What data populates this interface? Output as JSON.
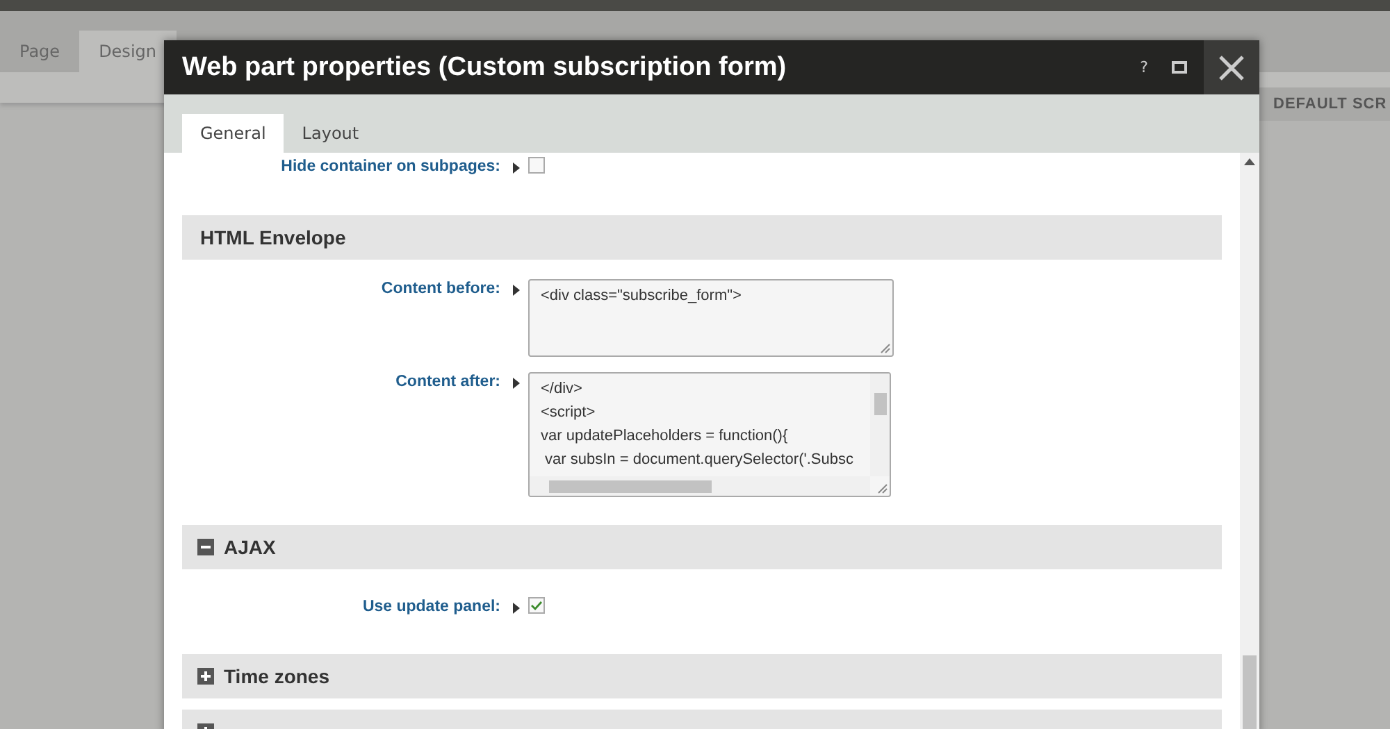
{
  "background": {
    "tabs": [
      {
        "label": "Page",
        "selected": false
      },
      {
        "label": "Design",
        "selected": true
      }
    ],
    "button": "DEFAULT SCR"
  },
  "dialog": {
    "title": "Web part properties (Custom subscription form)",
    "help": "?",
    "tabs": [
      {
        "label": "General",
        "selected": true
      },
      {
        "label": "Layout",
        "selected": false
      }
    ],
    "items": [
      {
        "kind": "checkbox",
        "label": "Hide container on subpages:",
        "checked": false
      },
      {
        "kind": "category",
        "title": "HTML Envelope"
      },
      {
        "kind": "textarea",
        "label": "Content before:",
        "scrollable": false,
        "lines": [
          "<div class=\"subscribe_form\">"
        ]
      },
      {
        "kind": "textarea",
        "label": "Content after:",
        "scrollable": true,
        "lines": [
          "</div>",
          "<script>",
          "var updatePlaceholders = function(){",
          " var subsIn = document.querySelector('.Subsc"
        ]
      },
      {
        "kind": "category",
        "title": "AJAX",
        "expanded": true
      },
      {
        "kind": "checkbox",
        "label": "Use update panel:",
        "checked": true
      },
      {
        "kind": "category",
        "title": "Time zones",
        "expanded": false
      },
      {
        "kind": "category",
        "expanded": false
      }
    ]
  }
}
